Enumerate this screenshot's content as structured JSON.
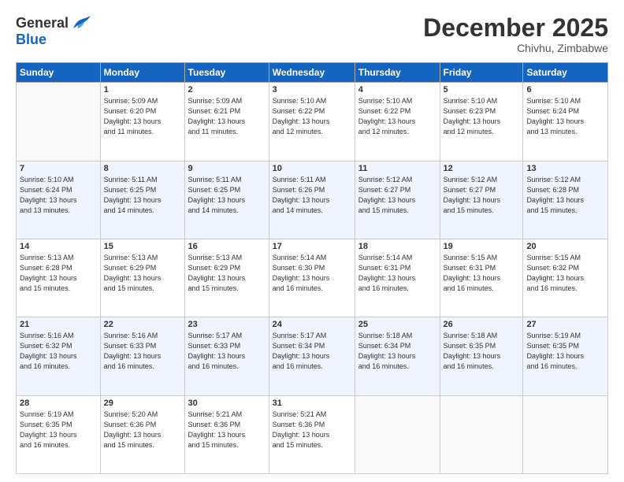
{
  "logo": {
    "general": "General",
    "blue": "Blue"
  },
  "header": {
    "month_year": "December 2025",
    "location": "Chivhu, Zimbabwe"
  },
  "days_of_week": [
    "Sunday",
    "Monday",
    "Tuesday",
    "Wednesday",
    "Thursday",
    "Friday",
    "Saturday"
  ],
  "weeks": [
    [
      {
        "day": "",
        "sunrise": "",
        "sunset": "",
        "daylight": ""
      },
      {
        "day": "1",
        "sunrise": "Sunrise: 5:09 AM",
        "sunset": "Sunset: 6:20 PM",
        "daylight": "Daylight: 13 hours and 11 minutes."
      },
      {
        "day": "2",
        "sunrise": "Sunrise: 5:09 AM",
        "sunset": "Sunset: 6:21 PM",
        "daylight": "Daylight: 13 hours and 11 minutes."
      },
      {
        "day": "3",
        "sunrise": "Sunrise: 5:10 AM",
        "sunset": "Sunset: 6:22 PM",
        "daylight": "Daylight: 13 hours and 12 minutes."
      },
      {
        "day": "4",
        "sunrise": "Sunrise: 5:10 AM",
        "sunset": "Sunset: 6:22 PM",
        "daylight": "Daylight: 13 hours and 12 minutes."
      },
      {
        "day": "5",
        "sunrise": "Sunrise: 5:10 AM",
        "sunset": "Sunset: 6:23 PM",
        "daylight": "Daylight: 13 hours and 12 minutes."
      },
      {
        "day": "6",
        "sunrise": "Sunrise: 5:10 AM",
        "sunset": "Sunset: 6:24 PM",
        "daylight": "Daylight: 13 hours and 13 minutes."
      }
    ],
    [
      {
        "day": "7",
        "sunrise": "Sunrise: 5:10 AM",
        "sunset": "Sunset: 6:24 PM",
        "daylight": "Daylight: 13 hours and 13 minutes."
      },
      {
        "day": "8",
        "sunrise": "Sunrise: 5:11 AM",
        "sunset": "Sunset: 6:25 PM",
        "daylight": "Daylight: 13 hours and 14 minutes."
      },
      {
        "day": "9",
        "sunrise": "Sunrise: 5:11 AM",
        "sunset": "Sunset: 6:25 PM",
        "daylight": "Daylight: 13 hours and 14 minutes."
      },
      {
        "day": "10",
        "sunrise": "Sunrise: 5:11 AM",
        "sunset": "Sunset: 6:26 PM",
        "daylight": "Daylight: 13 hours and 14 minutes."
      },
      {
        "day": "11",
        "sunrise": "Sunrise: 5:12 AM",
        "sunset": "Sunset: 6:27 PM",
        "daylight": "Daylight: 13 hours and 15 minutes."
      },
      {
        "day": "12",
        "sunrise": "Sunrise: 5:12 AM",
        "sunset": "Sunset: 6:27 PM",
        "daylight": "Daylight: 13 hours and 15 minutes."
      },
      {
        "day": "13",
        "sunrise": "Sunrise: 5:12 AM",
        "sunset": "Sunset: 6:28 PM",
        "daylight": "Daylight: 13 hours and 15 minutes."
      }
    ],
    [
      {
        "day": "14",
        "sunrise": "Sunrise: 5:13 AM",
        "sunset": "Sunset: 6:28 PM",
        "daylight": "Daylight: 13 hours and 15 minutes."
      },
      {
        "day": "15",
        "sunrise": "Sunrise: 5:13 AM",
        "sunset": "Sunset: 6:29 PM",
        "daylight": "Daylight: 13 hours and 15 minutes."
      },
      {
        "day": "16",
        "sunrise": "Sunrise: 5:13 AM",
        "sunset": "Sunset: 6:29 PM",
        "daylight": "Daylight: 13 hours and 15 minutes."
      },
      {
        "day": "17",
        "sunrise": "Sunrise: 5:14 AM",
        "sunset": "Sunset: 6:30 PM",
        "daylight": "Daylight: 13 hours and 16 minutes."
      },
      {
        "day": "18",
        "sunrise": "Sunrise: 5:14 AM",
        "sunset": "Sunset: 6:31 PM",
        "daylight": "Daylight: 13 hours and 16 minutes."
      },
      {
        "day": "19",
        "sunrise": "Sunrise: 5:15 AM",
        "sunset": "Sunset: 6:31 PM",
        "daylight": "Daylight: 13 hours and 16 minutes."
      },
      {
        "day": "20",
        "sunrise": "Sunrise: 5:15 AM",
        "sunset": "Sunset: 6:32 PM",
        "daylight": "Daylight: 13 hours and 16 minutes."
      }
    ],
    [
      {
        "day": "21",
        "sunrise": "Sunrise: 5:16 AM",
        "sunset": "Sunset: 6:32 PM",
        "daylight": "Daylight: 13 hours and 16 minutes."
      },
      {
        "day": "22",
        "sunrise": "Sunrise: 5:16 AM",
        "sunset": "Sunset: 6:33 PM",
        "daylight": "Daylight: 13 hours and 16 minutes."
      },
      {
        "day": "23",
        "sunrise": "Sunrise: 5:17 AM",
        "sunset": "Sunset: 6:33 PM",
        "daylight": "Daylight: 13 hours and 16 minutes."
      },
      {
        "day": "24",
        "sunrise": "Sunrise: 5:17 AM",
        "sunset": "Sunset: 6:34 PM",
        "daylight": "Daylight: 13 hours and 16 minutes."
      },
      {
        "day": "25",
        "sunrise": "Sunrise: 5:18 AM",
        "sunset": "Sunset: 6:34 PM",
        "daylight": "Daylight: 13 hours and 16 minutes."
      },
      {
        "day": "26",
        "sunrise": "Sunrise: 5:18 AM",
        "sunset": "Sunset: 6:35 PM",
        "daylight": "Daylight: 13 hours and 16 minutes."
      },
      {
        "day": "27",
        "sunrise": "Sunrise: 5:19 AM",
        "sunset": "Sunset: 6:35 PM",
        "daylight": "Daylight: 13 hours and 16 minutes."
      }
    ],
    [
      {
        "day": "28",
        "sunrise": "Sunrise: 5:19 AM",
        "sunset": "Sunset: 6:35 PM",
        "daylight": "Daylight: 13 hours and 16 minutes."
      },
      {
        "day": "29",
        "sunrise": "Sunrise: 5:20 AM",
        "sunset": "Sunset: 6:36 PM",
        "daylight": "Daylight: 13 hours and 15 minutes."
      },
      {
        "day": "30",
        "sunrise": "Sunrise: 5:21 AM",
        "sunset": "Sunset: 6:36 PM",
        "daylight": "Daylight: 13 hours and 15 minutes."
      },
      {
        "day": "31",
        "sunrise": "Sunrise: 5:21 AM",
        "sunset": "Sunset: 6:36 PM",
        "daylight": "Daylight: 13 hours and 15 minutes."
      },
      {
        "day": "",
        "sunrise": "",
        "sunset": "",
        "daylight": ""
      },
      {
        "day": "",
        "sunrise": "",
        "sunset": "",
        "daylight": ""
      },
      {
        "day": "",
        "sunrise": "",
        "sunset": "",
        "daylight": ""
      }
    ]
  ]
}
